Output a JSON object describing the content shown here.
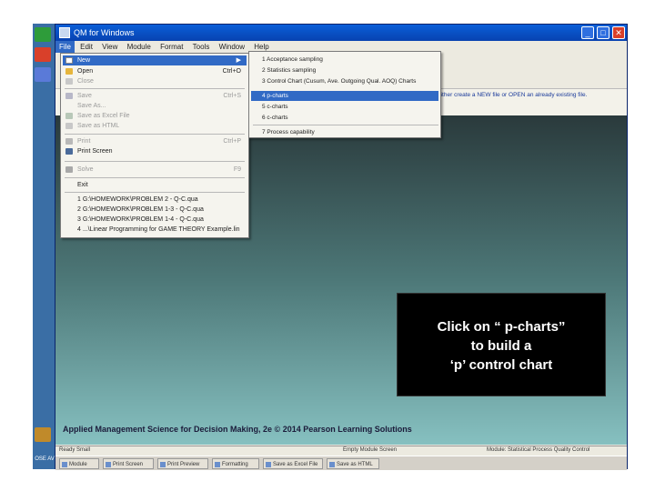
{
  "window": {
    "title": "QM for Windows",
    "buttons": {
      "minimize": "_",
      "maximize": "□",
      "close": "✕"
    }
  },
  "menubar": [
    "File",
    "Edit",
    "View",
    "Module",
    "Format",
    "Tools",
    "Window",
    "Help"
  ],
  "file_menu": {
    "items": [
      {
        "label": "New",
        "shortcut": "",
        "state": "selected"
      },
      {
        "label": "Open",
        "shortcut": "Ctrl+O",
        "state": "enabled"
      },
      {
        "label": "Close",
        "shortcut": "",
        "state": "disabled"
      },
      {
        "label": "Save",
        "shortcut": "Ctrl+S",
        "state": "disabled"
      },
      {
        "label": "Save As...",
        "shortcut": "",
        "state": "disabled"
      },
      {
        "label": "Save as Excel File",
        "shortcut": "",
        "state": "disabled"
      },
      {
        "label": "Save as HTML",
        "shortcut": "",
        "state": "disabled"
      },
      {
        "label": "Print",
        "shortcut": "Ctrl+P",
        "state": "disabled"
      },
      {
        "label": "Print Screen",
        "shortcut": "",
        "state": "enabled"
      },
      {
        "label": "Solve",
        "shortcut": "F9",
        "state": "disabled"
      },
      {
        "label": "Exit",
        "shortcut": "",
        "state": "enabled"
      },
      {
        "label": "1 G:\\HOMEWORK\\PROBLEM 2 - Q-C.qua",
        "shortcut": "",
        "state": "enabled"
      },
      {
        "label": "2 G:\\HOMEWORK\\PROBLEM 1-3 - Q-C.qua",
        "shortcut": "",
        "state": "enabled"
      },
      {
        "label": "3 G:\\HOMEWORK\\PROBLEM 1-4 - Q-C.qua",
        "shortcut": "",
        "state": "enabled"
      },
      {
        "label": "4 ...\\Linear Programming for GAME THEORY Example.lin",
        "shortcut": "",
        "state": "enabled"
      }
    ]
  },
  "new_submenu": {
    "items": [
      {
        "label": "1 Acceptance sampling",
        "state": "enabled"
      },
      {
        "label": "2 Statistics sampling",
        "state": "enabled"
      },
      {
        "label": "3 Control Chart (Cusum, Ave. Outgoing Qual. AOQ) Charts",
        "state": "enabled"
      },
      {
        "label": "4 p-charts",
        "state": "selected"
      },
      {
        "label": "5 c-charts",
        "state": "enabled"
      },
      {
        "label": "6 c-charts",
        "state": "enabled"
      },
      {
        "label": "7 Process capability",
        "state": "enabled"
      }
    ]
  },
  "hint_text": "either create a NEW file or OPEN an already existing file.",
  "footer_text": "Applied Management Science for Decision Making, 2e © 2014 Pearson Learning Solutions",
  "status": {
    "left": "Ready  Small",
    "middle": "Empty Module Screen",
    "right": "Module: Statistical Process Quality Control"
  },
  "taskbar": [
    "Module",
    "Print Screen",
    "Print Preview",
    "Formatting",
    "Save as Excel File",
    "Save as HTML"
  ],
  "desktop": {
    "labels": [
      "",
      "",
      "",
      "",
      "OSE AV"
    ]
  },
  "callout": {
    "line1": "Click on “ p-charts”",
    "line2": "to build a",
    "line3": "‘p’ control chart"
  }
}
